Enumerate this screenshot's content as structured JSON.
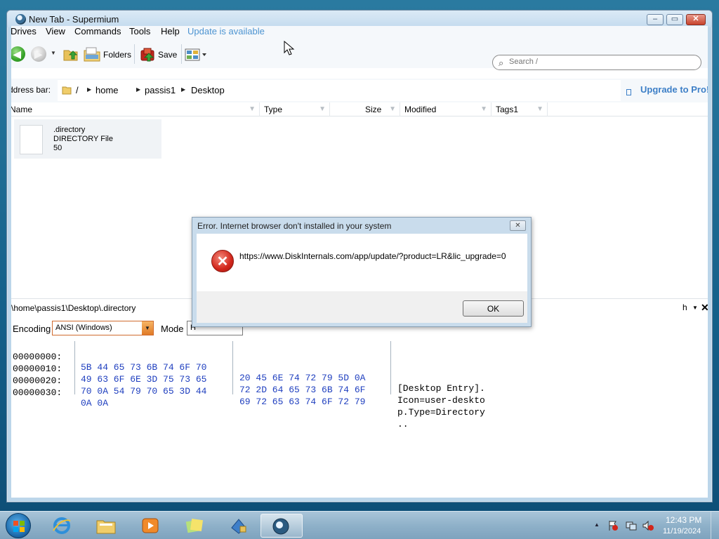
{
  "window": {
    "title": "New Tab - Supermium",
    "caption_min": "–",
    "caption_max": "▭",
    "caption_close": "✕"
  },
  "menu": {
    "items": [
      "Drives",
      "View",
      "Commands",
      "Tools",
      "Help"
    ],
    "update_label": "Update is available"
  },
  "toolbar": {
    "folders_label": "Folders",
    "save_label": "Save"
  },
  "search": {
    "placeholder": "Search /"
  },
  "address_bar": {
    "label": "Address bar:",
    "crumbs": [
      "/",
      "home",
      "passis1",
      "Desktop"
    ],
    "upgrade_label": "Upgrade to Pro!"
  },
  "columns": [
    "Name",
    "Type",
    "Size",
    "Modified",
    "Tags1"
  ],
  "file_item": {
    "name": ".directory",
    "type": "DIRECTORY File",
    "size": "50"
  },
  "hex_viewer": {
    "path": "\\home\\passis1\\Desktop\\.directory",
    "encoding_label": "Encoding",
    "encoding_value": "ANSI (Windows)",
    "mode_label": "Mode",
    "mode_value": "H",
    "h_label": "h",
    "close_label": "✕",
    "rows": [
      {
        "offset": "00000000:",
        "bytes1": "5B 44 65 73 6B 74 6F 70",
        "bytes2": "20 45 6E 74 72 79 5D 0A",
        "ascii": "[Desktop Entry]."
      },
      {
        "offset": "00000010:",
        "bytes1": "49 63 6F 6E 3D 75 73 65",
        "bytes2": "72 2D 64 65 73 6B 74 6F",
        "ascii": "Icon=user-deskto"
      },
      {
        "offset": "00000020:",
        "bytes1": "70 0A 54 79 70 65 3D 44",
        "bytes2": "69 72 65 63 74 6F 72 79",
        "ascii": "p.Type=Directory"
      },
      {
        "offset": "00000030:",
        "bytes1": "0A 0A",
        "bytes2": "",
        "ascii": ".."
      }
    ]
  },
  "dialog": {
    "title": "Error. Internet browser don't installed in your system",
    "message": "https://www.DiskInternals.com/app/update/?product=LR&lic_upgrade=0",
    "ok_label": "OK",
    "close_label": "✕"
  },
  "taskbar": {
    "time": "12:43 PM",
    "date": "11/19/2024"
  },
  "colors": {
    "accent_link": "#3d7fc7",
    "hex_bytes": "#1f3fbf",
    "error_red": "#d2261b"
  }
}
